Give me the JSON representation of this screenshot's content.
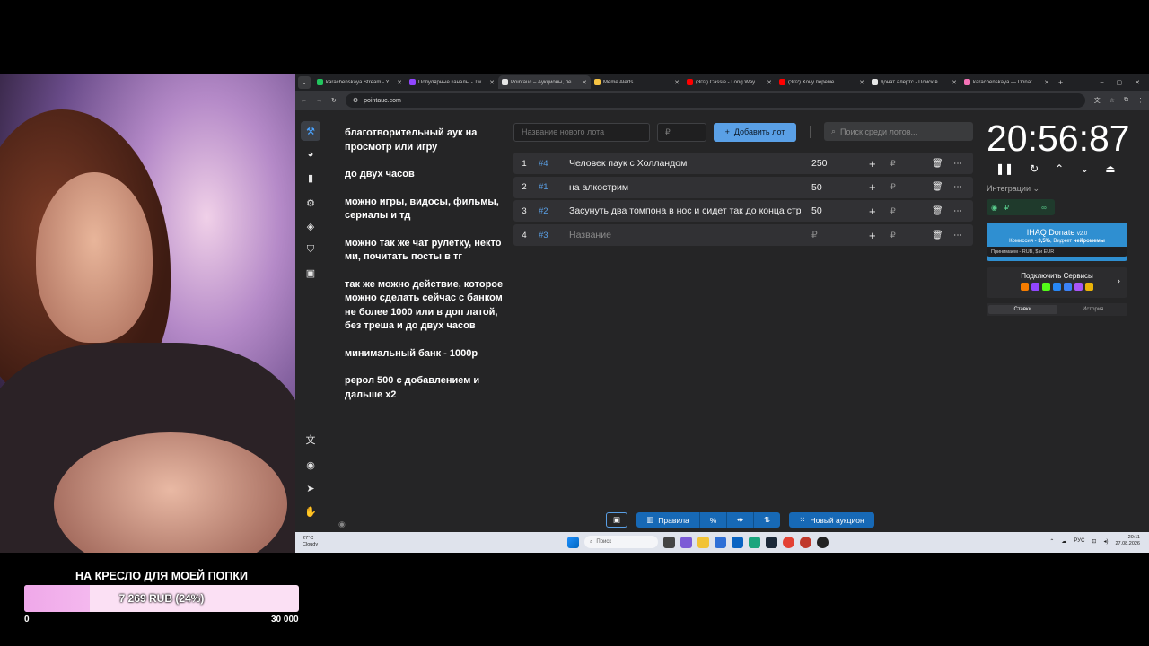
{
  "browser": {
    "tabs": [
      {
        "title": "karachenskaya Stream - Y",
        "color": "#22c55e"
      },
      {
        "title": "Популярные каналы - Tw",
        "color": "#9146ff"
      },
      {
        "title": "Pointauc – Аукционы, ле",
        "color": "#e6e6e6",
        "active": true
      },
      {
        "title": "Meme Alerts",
        "color": "#f6c343"
      },
      {
        "title": "(302) Cassie - Long Way",
        "color": "#ff0000"
      },
      {
        "title": "(302) Хочу переме",
        "color": "#ff0000"
      },
      {
        "title": "донат алертс - Поиск в",
        "color": "#e6e6e6"
      },
      {
        "title": "karachenskaya — Donat",
        "color": "#f472b6"
      }
    ],
    "url": "pointauc.com"
  },
  "notes": [
    "благотворительный аук на просмотр или игру",
    "до  двух часов",
    "можно игры, видосы, фильмы, сериалы и тд",
    "можно так же чат рулетку, некто ми, почитать посты в тг",
    "так же можно действие, которое можно сделать сейчас с банком не более 1000 или в доп латой, без треша  и до двух часов",
    "минимальный банк - 1000р",
    "рерол 500 с добавлением и дальше х2"
  ],
  "lotbar": {
    "name_placeholder": "Название нового лота",
    "amount_placeholder": "₽",
    "add_label": "Добавить лот",
    "search_placeholder": "Поиск среди лотов..."
  },
  "lots": [
    {
      "num": "1",
      "id": "#4",
      "name": "Человек паук с Холландом",
      "amount": "250",
      "currency": "₽"
    },
    {
      "num": "2",
      "id": "#1",
      "name": "на алкострим",
      "amount": "50",
      "currency": "₽"
    },
    {
      "num": "3",
      "id": "#2",
      "name": "Засунуть два томпона в нос и сидет так до конца стрима",
      "amount": "50",
      "currency": "₽"
    },
    {
      "num": "4",
      "id": "#3",
      "name": "Название",
      "amount": "₽",
      "currency": "₽",
      "placeholder": true
    }
  ],
  "timer": {
    "value": "20:56:87"
  },
  "integrations": {
    "label": "Интеграции",
    "currency": "₽",
    "donate_title": "IHAQ Donate",
    "donate_version": "v2.0",
    "donate_commission_label": "Комиссия - ",
    "donate_commission_value": "3,5%",
    "donate_widget_label": ", Виджет ",
    "donate_widget_value": "нейромемы",
    "donate_accepts": "Принимаем - RUB, $ и EUR",
    "connect_label": "Подключить Сервисы"
  },
  "stats_tabs": {
    "bets": "Ставки",
    "history": "История"
  },
  "bottom": {
    "rules": "Правила",
    "new_auction": "Новый аукцион",
    "percent": "%"
  },
  "taskbar": {
    "temp": "27°C",
    "weather": "Cloudy",
    "search": "Поиск",
    "lang": "РУС",
    "time": "20:11",
    "date": "27.08.2026"
  },
  "goal": {
    "title": "НА КРЕСЛО ДЛЯ МОЕЙ ПОПКИ",
    "progress_text": "7 269 RUB (24%)",
    "fraction": 0.24,
    "min": "0",
    "max": "30 000"
  }
}
